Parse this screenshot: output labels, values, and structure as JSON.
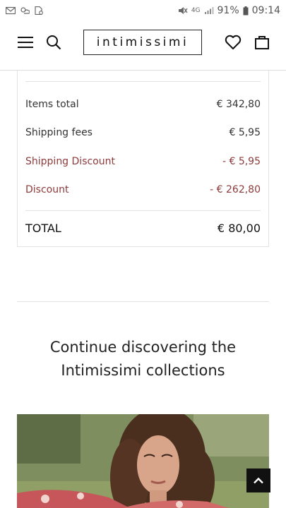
{
  "status_bar": {
    "battery": "91%",
    "time": "09:14",
    "network": "4G"
  },
  "header": {
    "logo": "intimissimi"
  },
  "summary": {
    "items_total_label": "Items total",
    "items_total_value": "€ 342,80",
    "shipping_label": "Shipping fees",
    "shipping_value": "€ 5,95",
    "shipping_discount_label": "Shipping Discount",
    "shipping_discount_value": "- € 5,95",
    "discount_label": "Discount",
    "discount_value": "- € 262,80",
    "total_label": "TOTAL",
    "total_value": "€ 80,00"
  },
  "discover": {
    "title_line1": "Continue discovering the",
    "title_line2": "Intimissimi collections"
  },
  "colors": {
    "discount": "#8c3a3a",
    "text": "#222222",
    "border": "#e3e3e3"
  }
}
